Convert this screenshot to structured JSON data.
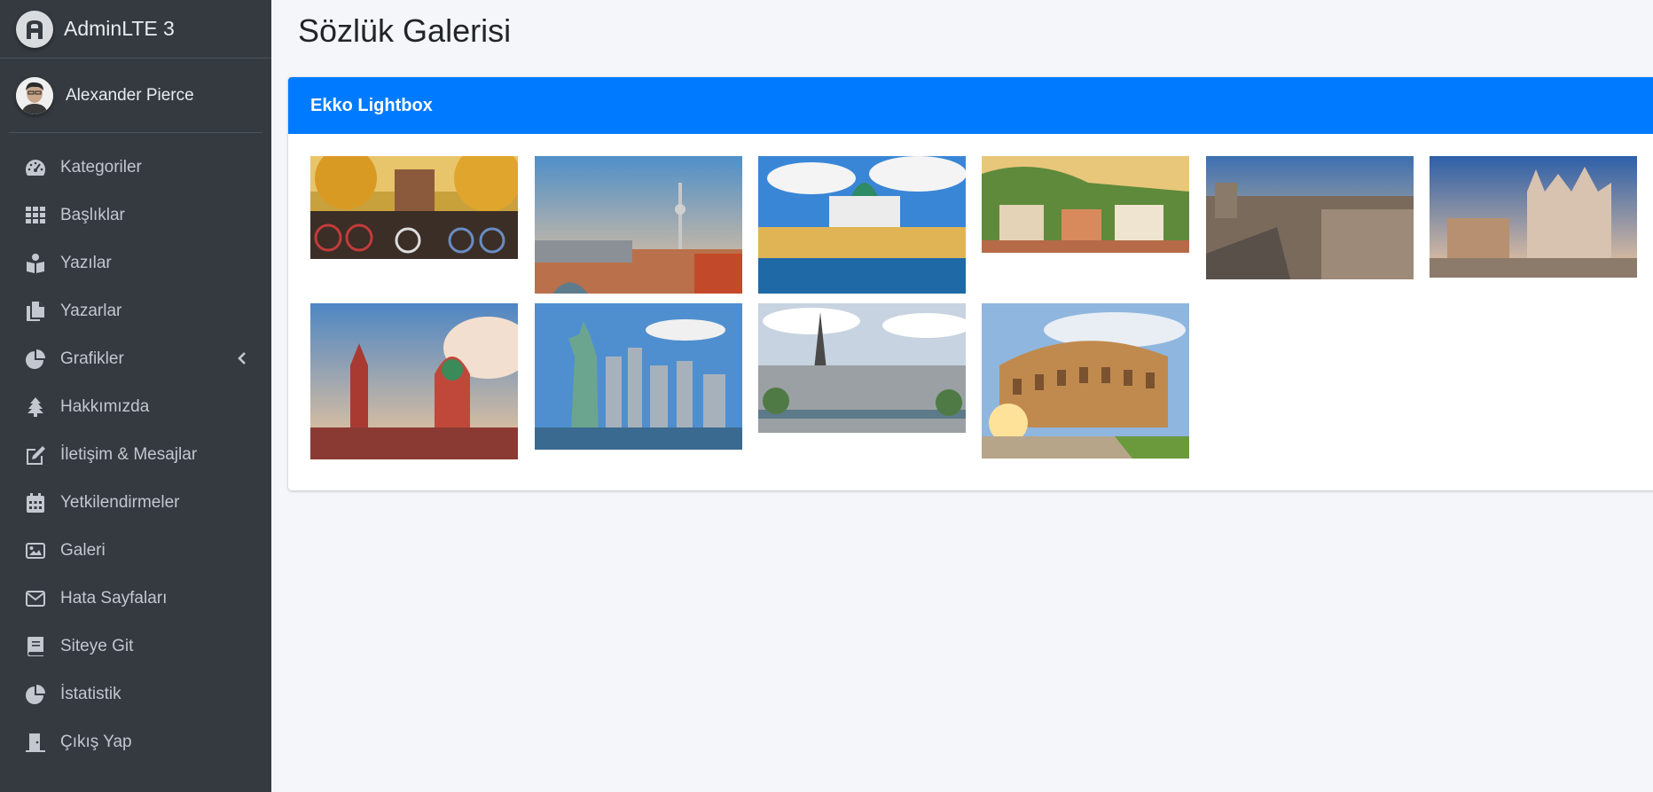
{
  "brand": {
    "name": "AdminLTE 3"
  },
  "user": {
    "name": "Alexander Pierce"
  },
  "sidebar": {
    "items": [
      {
        "label": "Kategoriler",
        "icon": "tachometer-icon"
      },
      {
        "label": "Başlıklar",
        "icon": "grid-icon"
      },
      {
        "label": "Yazılar",
        "icon": "book-reader-icon"
      },
      {
        "label": "Yazarlar",
        "icon": "copy-icon"
      },
      {
        "label": "Grafikler",
        "icon": "pie-chart-icon"
      },
      {
        "label": "Hakkımızda",
        "icon": "tree-icon"
      },
      {
        "label": "İletişim & Mesajlar",
        "icon": "edit-icon"
      },
      {
        "label": "Yetkilendirmeler",
        "icon": "calendar-icon"
      },
      {
        "label": "Galeri",
        "icon": "image-icon"
      },
      {
        "label": "Hata Sayfaları",
        "icon": "envelope-icon"
      },
      {
        "label": "Siteye Git",
        "icon": "book-icon"
      },
      {
        "label": "İstatistik",
        "icon": "pie-chart-icon"
      },
      {
        "label": "Çıkış Yap",
        "icon": "door-icon"
      }
    ]
  },
  "page": {
    "title": "Sözlük Galerisi"
  },
  "card": {
    "title": "Ekko Lightbox"
  },
  "gallery": {
    "images": [
      {
        "subject": "Amsterdam canal with bicycles"
      },
      {
        "subject": "Berlin TV tower skyline"
      },
      {
        "subject": "Helsinki cathedral harbor"
      },
      {
        "subject": "Lisbon hillside"
      },
      {
        "subject": "Madrid rooftops"
      },
      {
        "subject": "Milan cathedral"
      },
      {
        "subject": "Moscow Red Square"
      },
      {
        "subject": "New York Statue of Liberty"
      },
      {
        "subject": "Paris Eiffel Tower"
      },
      {
        "subject": "Rome Colosseum"
      }
    ]
  },
  "colors": {
    "sidebar": "#343a40",
    "accent": "#007bff",
    "background": "#f4f6f9"
  }
}
